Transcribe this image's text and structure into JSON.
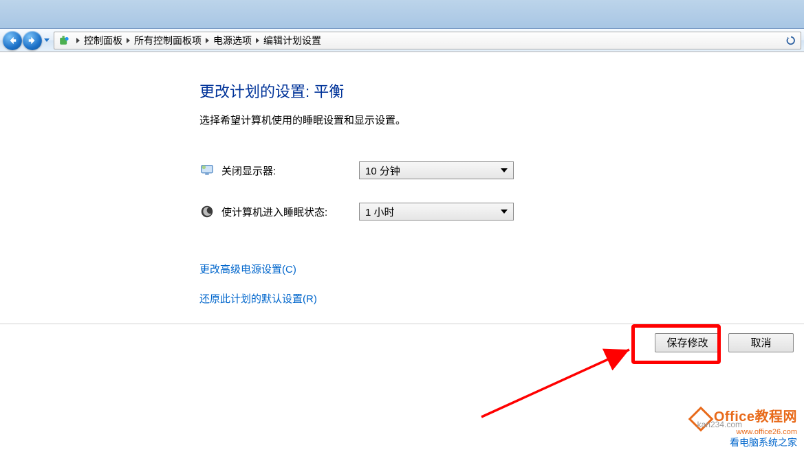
{
  "breadcrumb": {
    "items": [
      "控制面板",
      "所有控制面板项",
      "电源选项",
      "编辑计划设置"
    ]
  },
  "main": {
    "heading": "更改计划的设置: 平衡",
    "subheading": "选择希望计算机使用的睡眠设置和显示设置。",
    "display_off_label": "关闭显示器:",
    "display_off_value": "10 分钟",
    "sleep_label": "使计算机进入睡眠状态:",
    "sleep_value": "1 小时",
    "link_advanced": "更改高级电源设置(C)",
    "link_restore": "还原此计划的默认设置(R)"
  },
  "footer": {
    "save_label": "保存修改",
    "cancel_label": "取消"
  },
  "watermark": {
    "brand": "Office教程网",
    "url": "www.office26.com",
    "overlay": "kan234.com",
    "sub": "看电脑系统之家"
  }
}
